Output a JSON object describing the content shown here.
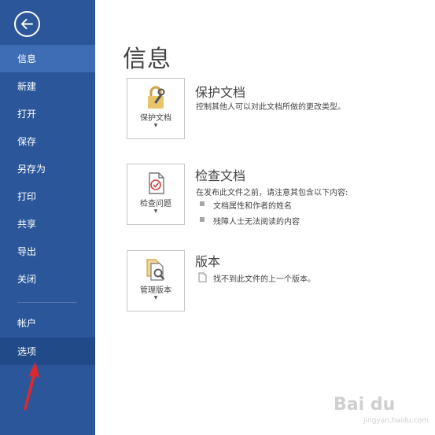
{
  "sidebar": {
    "items": [
      {
        "label": "信息"
      },
      {
        "label": "新建"
      },
      {
        "label": "打开"
      },
      {
        "label": "保存"
      },
      {
        "label": "另存为"
      },
      {
        "label": "打印"
      },
      {
        "label": "共享"
      },
      {
        "label": "导出"
      },
      {
        "label": "关闭"
      }
    ],
    "bottom_items": [
      {
        "label": "帐户"
      },
      {
        "label": "选项"
      }
    ]
  },
  "main": {
    "title": "信息",
    "protect": {
      "button_label": "保护文档",
      "title": "保护文档",
      "description": "控制其他人可以对此文档所做的更改类型。"
    },
    "inspect": {
      "button_label": "检查问题",
      "title": "检查文档",
      "description": "在发布此文件之前，请注意其包含以下内容:",
      "bullets": [
        "文档属性和作者的姓名",
        "残障人士无法阅读的内容"
      ]
    },
    "versions": {
      "button_label": "管理版本",
      "title": "版本",
      "description": "找不到此文件的上一个版本。"
    }
  },
  "watermark": {
    "text": "Bai du",
    "sub": "jingyan.baidu.com"
  },
  "colors": {
    "sidebar": "#2b579a",
    "sidebar_active": "#3e6db5",
    "arrow": "#e0282b"
  }
}
